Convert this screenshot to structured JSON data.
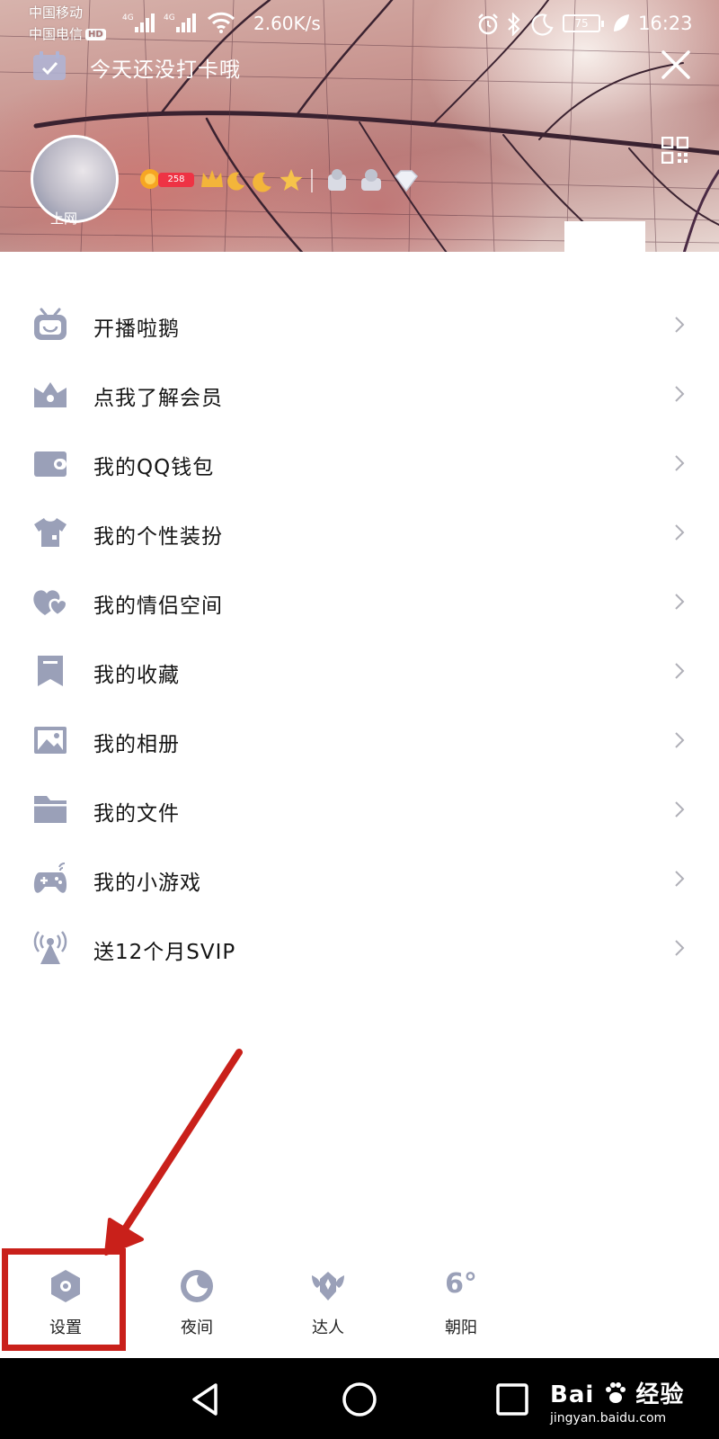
{
  "status_bar": {
    "carrier1": "中国移动",
    "carrier2": "中国电信",
    "hd_badge": "HD",
    "net_type1": "4G",
    "net_type2": "4G",
    "speed": "2.60K/s",
    "battery": "75",
    "time": "16:23"
  },
  "header": {
    "checkin_text": "今天还没打卡哦",
    "avatar_label": "上网",
    "level_badge": "258"
  },
  "menu": {
    "items": [
      {
        "label": "开播啦鹅",
        "icon": "tv-robot-icon"
      },
      {
        "label": "点我了解会员",
        "icon": "crown-icon"
      },
      {
        "label": "我的QQ钱包",
        "icon": "wallet-icon"
      },
      {
        "label": "我的个性装扮",
        "icon": "tshirt-icon"
      },
      {
        "label": "我的情侣空间",
        "icon": "hearts-icon"
      },
      {
        "label": "我的收藏",
        "icon": "bookmark-icon"
      },
      {
        "label": "我的相册",
        "icon": "photo-icon"
      },
      {
        "label": "我的文件",
        "icon": "folder-icon"
      },
      {
        "label": "我的小游戏",
        "icon": "gamepad-icon"
      },
      {
        "label": "送12个月SVIP",
        "icon": "broadcast-tower-icon"
      }
    ]
  },
  "bottom_actions": {
    "settings": "设置",
    "night": "夜间",
    "expert": "达人",
    "weather_temp": "6°",
    "weather_city": "朝阳"
  },
  "watermark": {
    "brand": "Bai",
    "brand_cn": "经验",
    "url": "jingyan.baidu.com"
  },
  "colors": {
    "icon": "#9aa0b8",
    "annotation_red": "#c9201a",
    "chevron": "#b0b0b8"
  }
}
